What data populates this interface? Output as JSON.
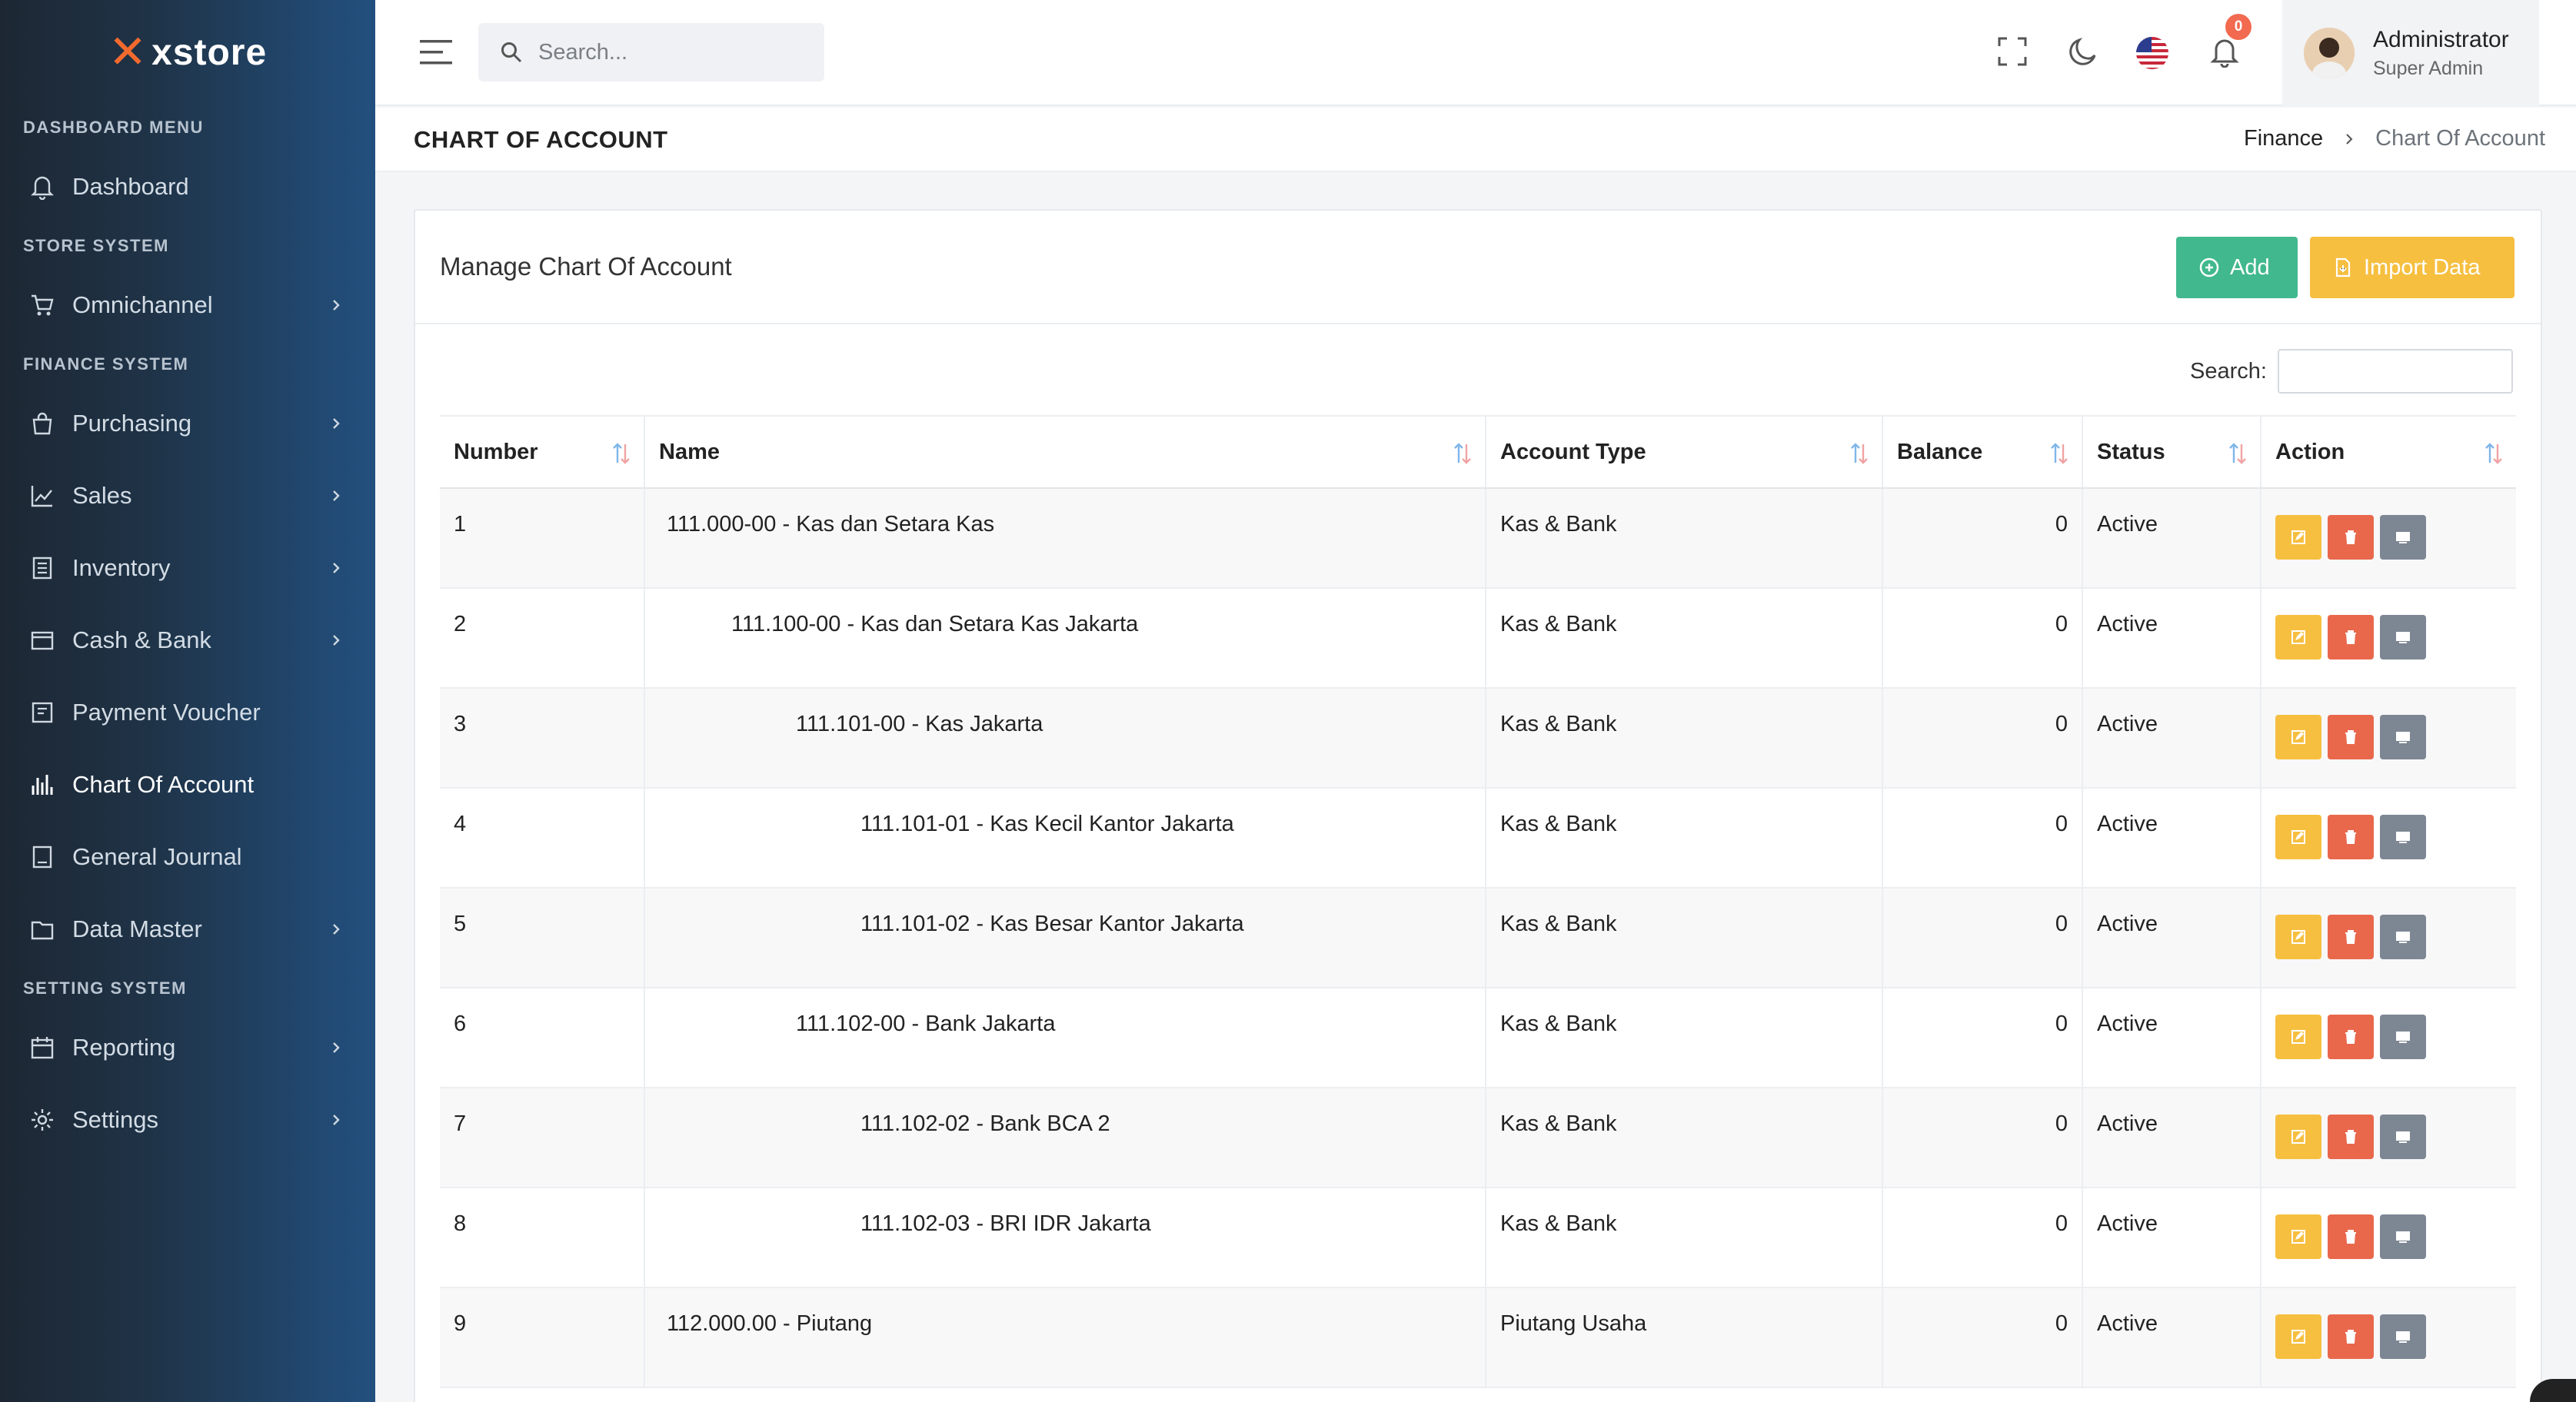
{
  "app": {
    "logo_text": "xstore"
  },
  "sidebar": {
    "sections": [
      {
        "title": "DASHBOARD MENU",
        "items": [
          {
            "label": "Dashboard",
            "icon": "bell-outline-icon",
            "has_children": false
          }
        ]
      },
      {
        "title": "STORE SYSTEM",
        "items": [
          {
            "label": "Omnichannel",
            "icon": "cart-icon",
            "has_children": true
          }
        ]
      },
      {
        "title": "FINANCE SYSTEM",
        "items": [
          {
            "label": "Purchasing",
            "icon": "bag-icon",
            "has_children": true
          },
          {
            "label": "Sales",
            "icon": "chart-line-icon",
            "has_children": true
          },
          {
            "label": "Inventory",
            "icon": "list-icon",
            "has_children": true
          },
          {
            "label": "Cash & Bank",
            "icon": "wallet-icon",
            "has_children": true
          },
          {
            "label": "Payment Voucher",
            "icon": "receipt-icon",
            "has_children": false
          },
          {
            "label": "Chart Of Account",
            "icon": "bar-chart-icon",
            "has_children": false,
            "active": true
          },
          {
            "label": "General Journal",
            "icon": "journal-icon",
            "has_children": false
          },
          {
            "label": "Data Master",
            "icon": "folder-icon",
            "has_children": true
          }
        ]
      },
      {
        "title": "SETTING SYSTEM",
        "items": [
          {
            "label": "Reporting",
            "icon": "calendar-icon",
            "has_children": true
          },
          {
            "label": "Settings",
            "icon": "gear-icon",
            "has_children": true
          }
        ]
      }
    ]
  },
  "header": {
    "search_placeholder": "Search...",
    "notification_count": "0",
    "user": {
      "name": "Administrator",
      "role": "Super Admin"
    }
  },
  "page": {
    "title": "CHART OF ACCOUNT",
    "breadcrumb": [
      "Finance",
      "Chart Of Account"
    ]
  },
  "card": {
    "title": "Manage Chart Of Account",
    "add_label": "Add",
    "import_label": "Import Data",
    "search_label": "Search:"
  },
  "table": {
    "columns": [
      "Number",
      "Name",
      "Account Type",
      "Balance",
      "Status",
      "Action"
    ],
    "rows": [
      {
        "number": "1",
        "name": "111.000-00 - Kas dan Setara Kas",
        "level": 0,
        "type": "Kas & Bank",
        "balance": "0",
        "status": "Active"
      },
      {
        "number": "2",
        "name": "111.100-00 - Kas dan Setara Kas Jakarta",
        "level": 1,
        "type": "Kas & Bank",
        "balance": "0",
        "status": "Active"
      },
      {
        "number": "3",
        "name": "111.101-00 - Kas Jakarta",
        "level": 2,
        "type": "Kas & Bank",
        "balance": "0",
        "status": "Active"
      },
      {
        "number": "4",
        "name": "111.101-01 - Kas Kecil Kantor Jakarta",
        "level": 3,
        "type": "Kas & Bank",
        "balance": "0",
        "status": "Active"
      },
      {
        "number": "5",
        "name": "111.101-02 - Kas Besar Kantor Jakarta",
        "level": 3,
        "type": "Kas & Bank",
        "balance": "0",
        "status": "Active"
      },
      {
        "number": "6",
        "name": "111.102-00 - Bank Jakarta",
        "level": 2,
        "type": "Kas & Bank",
        "balance": "0",
        "status": "Active"
      },
      {
        "number": "7",
        "name": "111.102-02 - Bank BCA 2",
        "level": 3,
        "type": "Kas & Bank",
        "balance": "0",
        "status": "Active"
      },
      {
        "number": "8",
        "name": "111.102-03 - BRI IDR Jakarta",
        "level": 3,
        "type": "Kas & Bank",
        "balance": "0",
        "status": "Active"
      },
      {
        "number": "9",
        "name": "112.000.00 - Piutang",
        "level": 0,
        "type": "Piutang Usaha",
        "balance": "0",
        "status": "Active"
      }
    ]
  },
  "colors": {
    "add_button": "#41b88d",
    "import_button": "#f6bf40",
    "edit_button": "#f6bf40",
    "delete_button": "#e9684c",
    "view_button": "#7d8693",
    "badge": "#f26a4f"
  }
}
